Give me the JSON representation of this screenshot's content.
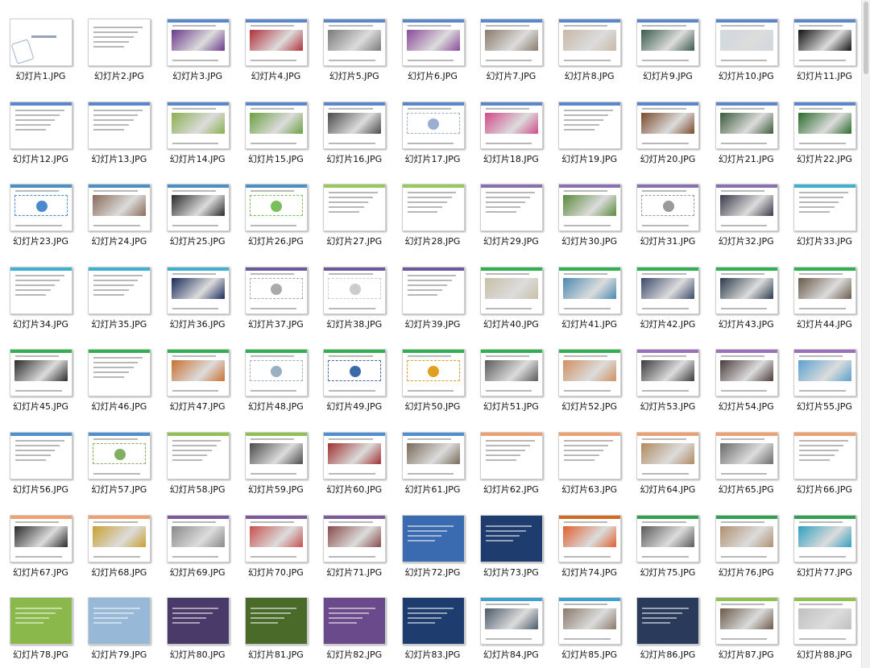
{
  "thumbnails": [
    {
      "label": "幻灯片1.JPG",
      "bar": "#ffffff",
      "style": "title"
    },
    {
      "label": "幻灯片2.JPG",
      "bar": "#ffffff",
      "style": "text"
    },
    {
      "label": "幻灯片3.JPG",
      "bar": "#5b86c9",
      "style": "photo",
      "accent": "#6a3a8a"
    },
    {
      "label": "幻灯片4.JPG",
      "bar": "#5b86c9",
      "style": "photo",
      "accent": "#b0303a"
    },
    {
      "label": "幻灯片5.JPG",
      "bar": "#5b86c9",
      "style": "photo",
      "accent": "#7a7a7a"
    },
    {
      "label": "幻灯片6.JPG",
      "bar": "#5b86c9",
      "style": "photo",
      "accent": "#8a4a9a"
    },
    {
      "label": "幻灯片7.JPG",
      "bar": "#5b86c9",
      "style": "photo",
      "accent": "#8a7a6a"
    },
    {
      "label": "幻灯片8.JPG",
      "bar": "#5b86c9",
      "style": "photo",
      "accent": "#c8b8a8"
    },
    {
      "label": "幻灯片9.JPG",
      "bar": "#5b86c9",
      "style": "photo",
      "accent": "#3a5a4a"
    },
    {
      "label": "幻灯片10.JPG",
      "bar": "#5b86c9",
      "style": "photo",
      "accent": "#cfd8e0"
    },
    {
      "label": "幻灯片11.JPG",
      "bar": "#5b86c9",
      "style": "photo",
      "accent": "#111111"
    },
    {
      "label": "幻灯片12.JPG",
      "bar": "#5b86c9",
      "style": "text"
    },
    {
      "label": "幻灯片13.JPG",
      "bar": "#5b86c9",
      "style": "text"
    },
    {
      "label": "幻灯片14.JPG",
      "bar": "#5b86c9",
      "style": "photo",
      "accent": "#8ab050"
    },
    {
      "label": "幻灯片15.JPG",
      "bar": "#5b86c9",
      "style": "photo",
      "accent": "#6aa040"
    },
    {
      "label": "幻灯片16.JPG",
      "bar": "#5b86c9",
      "style": "photo",
      "accent": "#4a4a4a"
    },
    {
      "label": "幻灯片17.JPG",
      "bar": "#5b86c9",
      "style": "diagram",
      "accent": "#9ab0d0"
    },
    {
      "label": "幻灯片18.JPG",
      "bar": "#5b86c9",
      "style": "photo",
      "accent": "#d04a8a"
    },
    {
      "label": "幻灯片19.JPG",
      "bar": "#5b86c9",
      "style": "text"
    },
    {
      "label": "幻灯片20.JPG",
      "bar": "#5b86c9",
      "style": "photo",
      "accent": "#7a4a2a"
    },
    {
      "label": "幻灯片21.JPG",
      "bar": "#5b86c9",
      "style": "photo",
      "accent": "#3a5a3a"
    },
    {
      "label": "幻灯片22.JPG",
      "bar": "#5b86c9",
      "style": "photo",
      "accent": "#2a6a2a"
    },
    {
      "label": "幻灯片23.JPG",
      "bar": "#4a8fc9",
      "style": "diagram",
      "accent": "#4a8ad0"
    },
    {
      "label": "幻灯片24.JPG",
      "bar": "#4a8fc9",
      "style": "photo",
      "accent": "#8a6a5a"
    },
    {
      "label": "幻灯片25.JPG",
      "bar": "#4a8fc9",
      "style": "photo",
      "accent": "#2a2a2a"
    },
    {
      "label": "幻灯片26.JPG",
      "bar": "#4a8fc9",
      "style": "diagram",
      "accent": "#7ac05a"
    },
    {
      "label": "幻灯片27.JPG",
      "bar": "#9ac860",
      "style": "text"
    },
    {
      "label": "幻灯片28.JPG",
      "bar": "#9ac860",
      "style": "text"
    },
    {
      "label": "幻灯片29.JPG",
      "bar": "#8a70b0",
      "style": "text"
    },
    {
      "label": "幻灯片30.JPG",
      "bar": "#8a70b0",
      "style": "photo",
      "accent": "#5a8a3a"
    },
    {
      "label": "幻灯片31.JPG",
      "bar": "#8a70b0",
      "style": "diagram",
      "accent": "#9a9a9a"
    },
    {
      "label": "幻灯片32.JPG",
      "bar": "#8a70b0",
      "style": "photo",
      "accent": "#3a3a4a"
    },
    {
      "label": "幻灯片33.JPG",
      "bar": "#40b0d0",
      "style": "text"
    },
    {
      "label": "幻灯片34.JPG",
      "bar": "#40b0d0",
      "style": "text"
    },
    {
      "label": "幻灯片35.JPG",
      "bar": "#40b0d0",
      "style": "text"
    },
    {
      "label": "幻灯片36.JPG",
      "bar": "#40b0d0",
      "style": "photo",
      "accent": "#1a2a5a"
    },
    {
      "label": "幻灯片37.JPG",
      "bar": "#6a5a9a",
      "style": "diagram",
      "accent": "#aaaaaa"
    },
    {
      "label": "幻灯片38.JPG",
      "bar": "#6a5a9a",
      "style": "diagram",
      "accent": "#cccccc"
    },
    {
      "label": "幻灯片39.JPG",
      "bar": "#6a5a9a",
      "style": "text"
    },
    {
      "label": "幻灯片40.JPG",
      "bar": "#30b050",
      "style": "photo",
      "accent": "#c8c0a8"
    },
    {
      "label": "幻灯片41.JPG",
      "bar": "#30b050",
      "style": "photo",
      "accent": "#4a8ab0"
    },
    {
      "label": "幻灯片42.JPG",
      "bar": "#30b050",
      "style": "photo",
      "accent": "#3a4a6a"
    },
    {
      "label": "幻灯片43.JPG",
      "bar": "#30b050",
      "style": "photo",
      "accent": "#2a3a4a"
    },
    {
      "label": "幻灯片44.JPG",
      "bar": "#30b050",
      "style": "photo",
      "accent": "#6a5a4a"
    },
    {
      "label": "幻灯片45.JPG",
      "bar": "#30b050",
      "style": "photo",
      "accent": "#2a2a2a"
    },
    {
      "label": "幻灯片46.JPG",
      "bar": "#30b050",
      "style": "text"
    },
    {
      "label": "幻灯片47.JPG",
      "bar": "#30b050",
      "style": "photo",
      "accent": "#c87030"
    },
    {
      "label": "幻灯片48.JPG",
      "bar": "#30b050",
      "style": "diagram",
      "accent": "#9ab0c0"
    },
    {
      "label": "幻灯片49.JPG",
      "bar": "#30b050",
      "style": "diagram",
      "accent": "#3a6aa8"
    },
    {
      "label": "幻灯片50.JPG",
      "bar": "#30b050",
      "style": "diagram",
      "accent": "#e0a020"
    },
    {
      "label": "幻灯片51.JPG",
      "bar": "#30b050",
      "style": "photo",
      "accent": "#5a5a5a"
    },
    {
      "label": "幻灯片52.JPG",
      "bar": "#30b050",
      "style": "photo",
      "accent": "#d09060"
    },
    {
      "label": "幻灯片53.JPG",
      "bar": "#9a70b8",
      "style": "photo",
      "accent": "#3a3a3a"
    },
    {
      "label": "幻灯片54.JPG",
      "bar": "#9a70b8",
      "style": "photo",
      "accent": "#4a3a3a"
    },
    {
      "label": "幻灯片55.JPG",
      "bar": "#9a70b8",
      "style": "photo",
      "accent": "#5aa0d0"
    },
    {
      "label": "幻灯片56.JPG",
      "bar": "#5090d0",
      "style": "text"
    },
    {
      "label": "幻灯片57.JPG",
      "bar": "#5090d0",
      "style": "diagram",
      "accent": "#80b060"
    },
    {
      "label": "幻灯片58.JPG",
      "bar": "#90c050",
      "style": "text"
    },
    {
      "label": "幻灯片59.JPG",
      "bar": "#90c050",
      "style": "photo",
      "accent": "#4a4a4a"
    },
    {
      "label": "幻灯片60.JPG",
      "bar": "#5090d0",
      "style": "photo",
      "accent": "#a03030"
    },
    {
      "label": "幻灯片61.JPG",
      "bar": "#5090d0",
      "style": "photo",
      "accent": "#7a6a5a"
    },
    {
      "label": "幻灯片62.JPG",
      "bar": "#f0a070",
      "style": "text"
    },
    {
      "label": "幻灯片63.JPG",
      "bar": "#f0a070",
      "style": "text"
    },
    {
      "label": "幻灯片64.JPG",
      "bar": "#f0a070",
      "style": "photo",
      "accent": "#b08a60"
    },
    {
      "label": "幻灯片65.JPG",
      "bar": "#f0a070",
      "style": "photo",
      "accent": "#6a6a6a"
    },
    {
      "label": "幻灯片66.JPG",
      "bar": "#f0a070",
      "style": "text"
    },
    {
      "label": "幻灯片67.JPG",
      "bar": "#f0a070",
      "style": "photo",
      "accent": "#2a2a2a"
    },
    {
      "label": "幻灯片68.JPG",
      "bar": "#f0a070",
      "style": "photo",
      "accent": "#c8a030"
    },
    {
      "label": "幻灯片69.JPG",
      "bar": "#7a5a9a",
      "style": "photo",
      "accent": "#8a8a8a"
    },
    {
      "label": "幻灯片70.JPG",
      "bar": "#7a5a9a",
      "style": "photo",
      "accent": "#c85050"
    },
    {
      "label": "幻灯片71.JPG",
      "bar": "#7a5a9a",
      "style": "photo",
      "accent": "#8a4a4a"
    },
    {
      "label": "幻灯片72.JPG",
      "bar": "#3a6ab0",
      "style": "dark",
      "accent": "#3a6ab0"
    },
    {
      "label": "幻灯片73.JPG",
      "bar": "#d06a20",
      "style": "dark",
      "accent": "#1f3c6e"
    },
    {
      "label": "幻灯片74.JPG",
      "bar": "#d06a20",
      "style": "photo",
      "accent": "#e06030"
    },
    {
      "label": "幻灯片75.JPG",
      "bar": "#30a050",
      "style": "photo",
      "accent": "#5a5a5a"
    },
    {
      "label": "幻灯片76.JPG",
      "bar": "#30a050",
      "style": "photo",
      "accent": "#b09070"
    },
    {
      "label": "幻灯片77.JPG",
      "bar": "#30a050",
      "style": "photo",
      "accent": "#30a0c0"
    },
    {
      "label": "幻灯片78.JPG",
      "bar": "#8ab84a",
      "style": "dark",
      "accent": "#8ab84a"
    },
    {
      "label": "幻灯片79.JPG",
      "bar": "#8ab84a",
      "style": "dark",
      "accent": "#98b8d8"
    },
    {
      "label": "幻灯片80.JPG",
      "bar": "#8ab84a",
      "style": "dark",
      "accent": "#4a3a6a"
    },
    {
      "label": "幻灯片81.JPG",
      "bar": "#8ab84a",
      "style": "dark",
      "accent": "#4a6a2a"
    },
    {
      "label": "幻灯片82.JPG",
      "bar": "#8ab84a",
      "style": "dark",
      "accent": "#6a4a8a"
    },
    {
      "label": "幻灯片83.JPG",
      "bar": "#40a0d0",
      "style": "dark",
      "accent": "#1f3c6e"
    },
    {
      "label": "幻灯片84.JPG",
      "bar": "#40a0d0",
      "style": "photo",
      "accent": "#4a5a6a"
    },
    {
      "label": "幻灯片85.JPG",
      "bar": "#40a0d0",
      "style": "photo",
      "accent": "#8a7a6a"
    },
    {
      "label": "幻灯片86.JPG",
      "bar": "#40a0d0",
      "style": "dark",
      "accent": "#2a3a5a"
    },
    {
      "label": "幻灯片87.JPG",
      "bar": "#90c050",
      "style": "photo",
      "accent": "#6a5a4a"
    },
    {
      "label": "幻灯片88.JPG",
      "bar": "#90c050",
      "style": "photo",
      "accent": "#c0c0c0"
    }
  ]
}
